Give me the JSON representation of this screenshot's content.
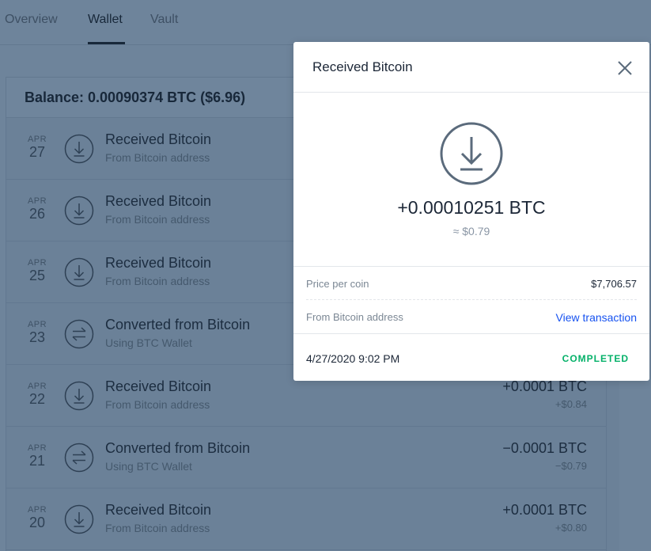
{
  "tabs": [
    {
      "label": "Overview"
    },
    {
      "label": "Wallet",
      "active": true
    },
    {
      "label": "Vault"
    }
  ],
  "balance": "Balance: 0.00090374 BTC ($6.96)",
  "transactions": [
    {
      "month": "APR",
      "day": "27",
      "title": "Received Bitcoin",
      "subtitle": "From Bitcoin address",
      "icon": "download-icon",
      "amount": "",
      "fiat": ""
    },
    {
      "month": "APR",
      "day": "26",
      "title": "Received Bitcoin",
      "subtitle": "From Bitcoin address",
      "icon": "download-icon",
      "amount": "",
      "fiat": ""
    },
    {
      "month": "APR",
      "day": "25",
      "title": "Received Bitcoin",
      "subtitle": "From Bitcoin address",
      "icon": "download-icon",
      "amount": "",
      "fiat": ""
    },
    {
      "month": "APR",
      "day": "23",
      "title": "Converted from Bitcoin",
      "subtitle": "Using BTC Wallet",
      "icon": "convert-icon",
      "amount": "",
      "fiat": ""
    },
    {
      "month": "APR",
      "day": "22",
      "title": "Received Bitcoin",
      "subtitle": "From Bitcoin address",
      "icon": "download-icon",
      "amount": "+0.0001 BTC",
      "fiat": "+$0.84"
    },
    {
      "month": "APR",
      "day": "21",
      "title": "Converted from Bitcoin",
      "subtitle": "Using BTC Wallet",
      "icon": "convert-icon",
      "amount": "−0.0001 BTC",
      "fiat": "−$0.79"
    },
    {
      "month": "APR",
      "day": "20",
      "title": "Received Bitcoin",
      "subtitle": "From Bitcoin address",
      "icon": "download-icon",
      "amount": "+0.0001 BTC",
      "fiat": "+$0.80"
    }
  ],
  "modal": {
    "title": "Received Bitcoin",
    "amount": "+0.00010251 BTC",
    "fiat": "≈ $0.79",
    "price_label": "Price per coin",
    "price_value": "$7,706.57",
    "from_label": "From Bitcoin address",
    "view_link": "View transaction",
    "date": "4/27/2020 9:02 PM",
    "status": "COMPLETED"
  },
  "colors": {
    "overlay_bg": "#6e849b",
    "link": "#1652f0",
    "status_completed": "#05b169"
  }
}
